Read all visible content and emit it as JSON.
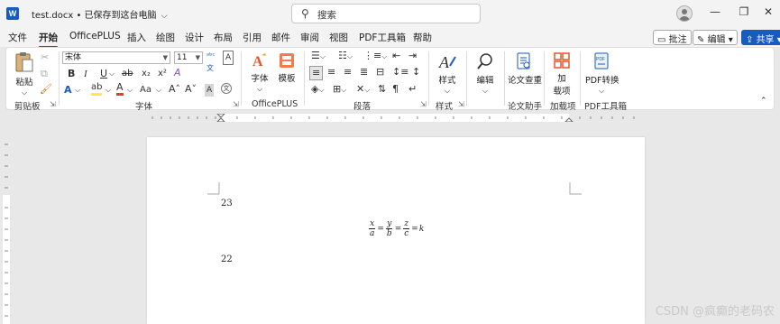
{
  "titlebar": {
    "logo_letter": "W",
    "doc_name": "test.docx",
    "save_status": "• 已保存到这台电脑",
    "search_placeholder": "搜索",
    "minimize": "—",
    "restore": "❐",
    "close": "✕"
  },
  "menu": {
    "tabs": [
      "文件",
      "开始",
      "OfficePLUS",
      "插入",
      "绘图",
      "设计",
      "布局",
      "引用",
      "邮件",
      "审阅",
      "视图",
      "PDF工具箱",
      "帮助"
    ],
    "active_tab": "开始",
    "comment_button": "批注",
    "edit_button": "编辑",
    "share_button": "共享"
  },
  "ribbon": {
    "clipboard": {
      "paste": "粘贴",
      "group_label": "剪贴板"
    },
    "font": {
      "font_name": "宋体",
      "font_size": "11",
      "bold": "B",
      "italic": "I",
      "underline": "U",
      "strike": "ab",
      "subscript": "x₂",
      "superscript": "x²",
      "effects": "A",
      "highlight": "ab",
      "color": "A",
      "aa": "Aa",
      "grow": "A˄",
      "shrink": "A˅",
      "clear": "A",
      "phonetic": "文",
      "group_label": "字体"
    },
    "officeplus": {
      "font_btn": "字体",
      "template_btn": "模板",
      "group_label": "OfficePLUS"
    },
    "paragraph": {
      "group_label": "段落"
    },
    "styles": {
      "styles_btn": "样式",
      "group_label": "样式"
    },
    "editing": {
      "edit_btn": "编辑"
    },
    "paper": {
      "check_btn": "论文查重",
      "group_label": "论文助手"
    },
    "addins": {
      "btn": "加\n载项",
      "line1": "加",
      "line2": "载项",
      "group_label": "加载项"
    },
    "pdf": {
      "convert_btn": "PDF转换",
      "group_label": "PDF工具箱"
    }
  },
  "document": {
    "line1": "23",
    "formula": {
      "n1": "x",
      "d1": "a",
      "n2": "y",
      "d2": "b",
      "n3": "z",
      "d3": "c",
      "eq": "=",
      "rhs": "k"
    },
    "line2": "22"
  },
  "watermark": "CSDN @疯癫的老码农",
  "colors": {
    "accent": "#185abd",
    "highlight_yellow": "#ffeb3b",
    "font_red": "#e53935",
    "ribbon_bg": "#ffffff",
    "chrome_bg": "#f3f3f3"
  }
}
